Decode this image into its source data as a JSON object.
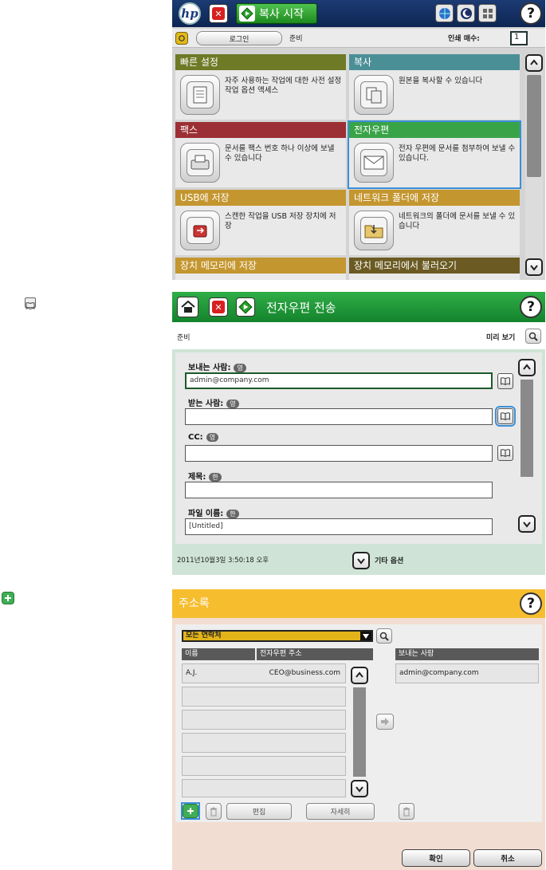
{
  "panel1": {
    "start_label": "복사 시작",
    "login_label": "로그인",
    "status": "준비",
    "copies_label": "인쇄 매수:",
    "copies_value": "1",
    "tiles": [
      {
        "title": "빠른 설정",
        "desc": "자주 사용하는 작업에 대한 사전 설정 작업 옵션 액세스",
        "color": "#6e7a26"
      },
      {
        "title": "복사",
        "desc": "원본을 복사할 수 있습니다",
        "color": "#4b8f96"
      },
      {
        "title": "팩스",
        "desc": "문서를 팩스 번호 하나 이상에 보낼 수 있습니다",
        "color": "#9c2f35"
      },
      {
        "title": "전자우편",
        "desc": "전자 우편에 문서를 첨부하여 보낼 수 있습니다.",
        "color": "#39a447"
      },
      {
        "title": "USB에 저장",
        "desc": "스캔한 작업을 USB 저장 장치에 저장",
        "color": "#c4962f"
      },
      {
        "title": "네트워크 폴더에 저장",
        "desc": "네트워크의 폴더에 문서를 보낼 수 있습니다",
        "color": "#c4962f"
      },
      {
        "title": "장치 메모리에 저장",
        "color": "#c4962f"
      },
      {
        "title": "장치 메모리에서 불러오기",
        "color": "#6b5a22"
      }
    ]
  },
  "panel2": {
    "title": "전자우편 전송",
    "status": "준비",
    "preview_label": "미리 보기",
    "from_label": "보내는 사람:",
    "from_lang": "영",
    "from_value": "admin@company.com",
    "to_label": "받는 사람:",
    "to_lang": "영",
    "to_value": "",
    "cc_label": "CC:",
    "cc_lang": "영",
    "cc_value": "",
    "subject_label": "제목:",
    "subject_lang": "한",
    "subject_value": "",
    "filename_label": "파일 이름:",
    "filename_lang": "한",
    "filename_value": "[Untitled]",
    "datetime": "2011년10월3일 3:50:18 오후",
    "more_options": "기타 옵션"
  },
  "panel3": {
    "title": "주소록",
    "filter_value": "모든 연락처",
    "col_name": "이름",
    "col_email": "전자우편 주소",
    "col_sender": "보내는 사람",
    "rows": [
      {
        "name": "A.J.",
        "email": "CEO@business.com"
      }
    ],
    "sender_value": "admin@company.com",
    "edit_label": "편집",
    "details_label": "자세히",
    "ok_label": "확인",
    "cancel_label": "취소"
  },
  "colors": {
    "accent_blue": "#3b8fd8",
    "email_green": "#2fae47",
    "addressbook_yellow": "#f6bd2e"
  }
}
